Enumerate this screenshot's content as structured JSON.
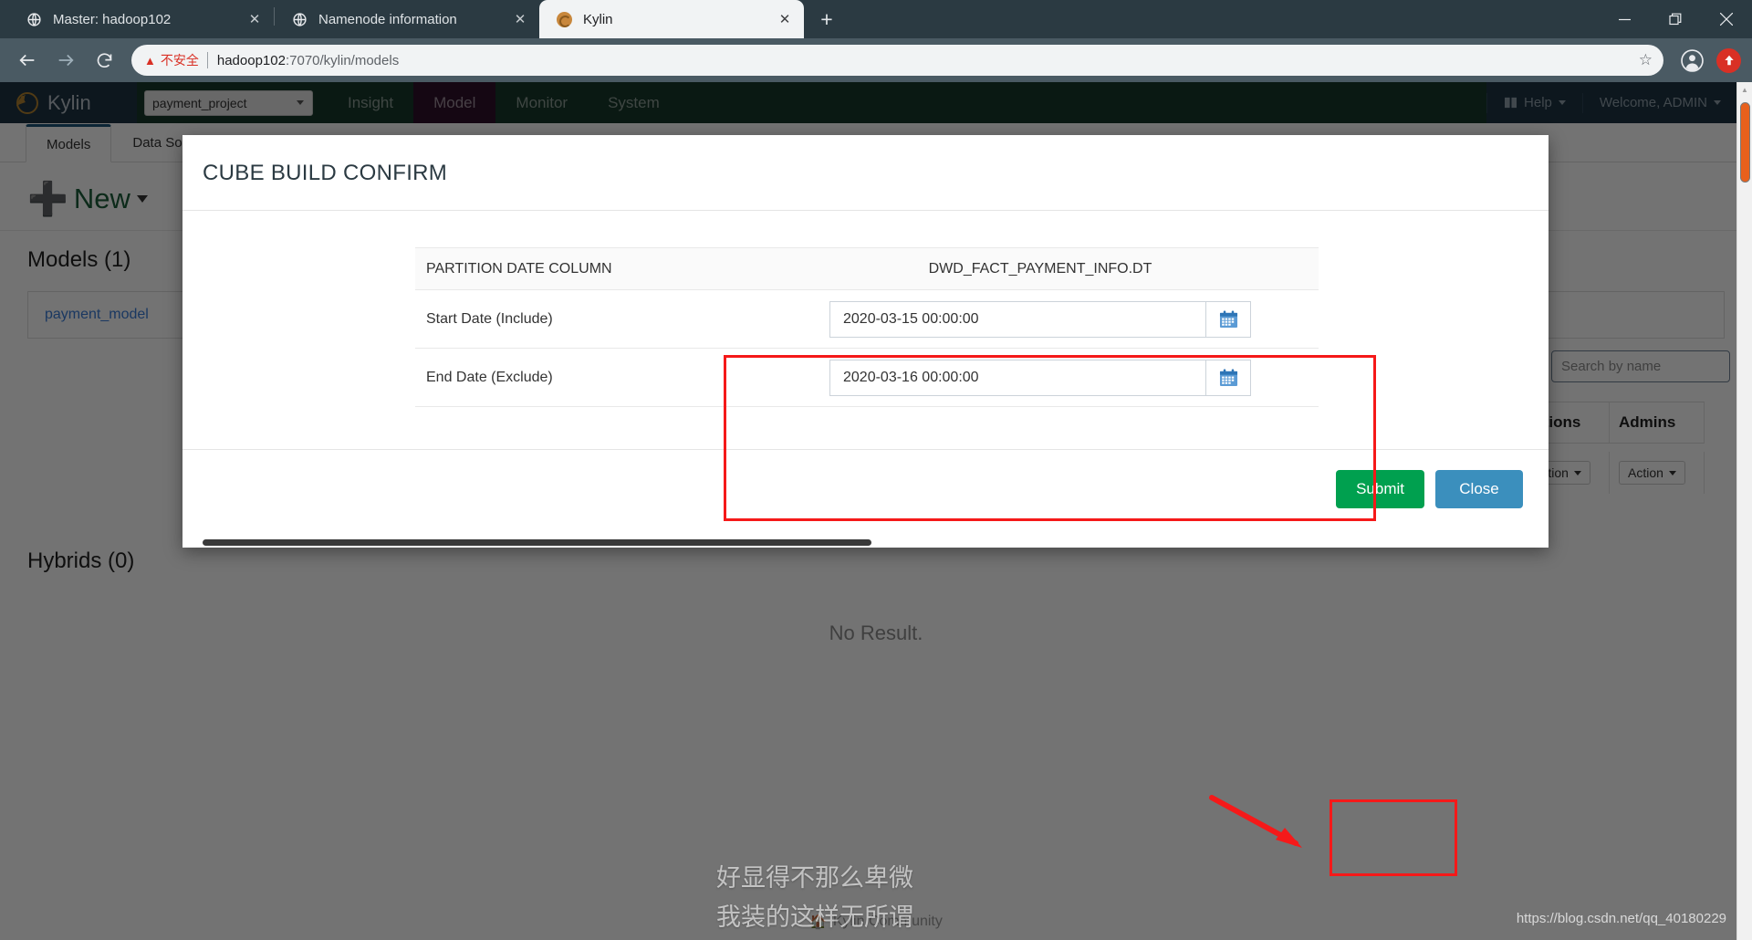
{
  "browser": {
    "tabs": [
      {
        "title": "Master: hadoop102",
        "favicon": "globe-icon",
        "active": false
      },
      {
        "title": "Namenode information",
        "favicon": "globe-icon",
        "active": false
      },
      {
        "title": "Kylin",
        "favicon": "kylin-icon",
        "active": true
      }
    ],
    "new_tab_label": "+",
    "window_controls": {
      "minimize": "—",
      "maximize": "❐",
      "close": "✕"
    },
    "toolbar": {
      "back": "←",
      "forward": "→",
      "reload": "↻",
      "security_warning_icon": "warning-triangle-icon",
      "security_label": "不安全",
      "url_host": "hadoop102",
      "url_path": ":7070/kylin/models",
      "bookmark_icon": "star-icon",
      "profile_icon": "account-icon",
      "update_icon": "update-arrow-icon"
    }
  },
  "kylin": {
    "brand": "Kylin",
    "project_selector": "payment_project",
    "nav_items": [
      {
        "label": "Insight",
        "active": false
      },
      {
        "label": "Model",
        "active": true
      },
      {
        "label": "Monitor",
        "active": false
      },
      {
        "label": "System",
        "active": false
      }
    ],
    "help_label": "Help",
    "welcome_label": "Welcome, ADMIN",
    "content_tabs": [
      {
        "label": "Models",
        "active": true
      },
      {
        "label": "Data Source",
        "active": false
      }
    ],
    "new_button": "New",
    "models_heading": "Models (1)",
    "model_name": "payment_model",
    "hybrids_heading": "Hybrids (0)",
    "no_result": "No Result.",
    "search_placeholder": "Search by name",
    "search_value": "",
    "grid_headers": [
      "Actions",
      "Admins"
    ],
    "grid_row": [
      "Action",
      "Action"
    ],
    "footer_text": "Kylin Community"
  },
  "modal": {
    "title": "CUBE BUILD CONFIRM",
    "rows": [
      {
        "label": "PARTITION DATE COLUMN",
        "value": "DWD_FACT_PAYMENT_INFO.DT",
        "type": "text"
      },
      {
        "label": "Start Date (Include)",
        "value": "2020-03-15 00:00:00",
        "type": "date"
      },
      {
        "label": "End Date (Exclude)",
        "value": "2020-03-16 00:00:00",
        "type": "date"
      }
    ],
    "submit_label": "Submit",
    "close_label": "Close",
    "annotation_color": "#f51919"
  },
  "watermark": {
    "line1": "好显得不那么卑微",
    "line2": "我装的这样无所谓",
    "url": "https://blog.csdn.net/qq_40180229"
  }
}
